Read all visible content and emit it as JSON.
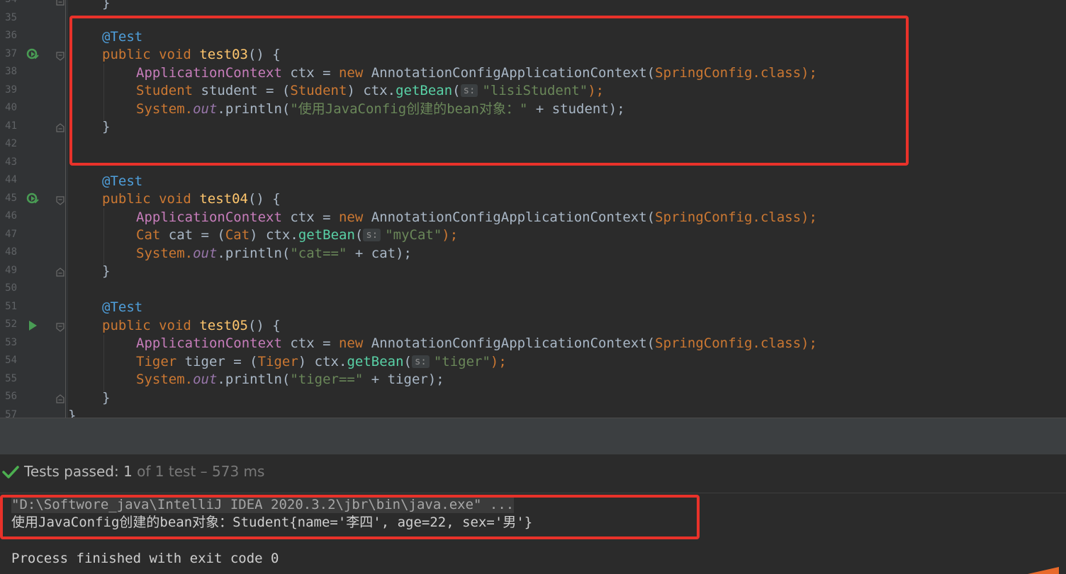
{
  "editor": {
    "line_numbers": [
      "34",
      "35",
      "36",
      "37",
      "38",
      "39",
      "40",
      "41",
      "42",
      "43",
      "44",
      "45",
      "46",
      "47",
      "48",
      "49",
      "50",
      "51",
      "52",
      "53",
      "54",
      "55",
      "56",
      "57"
    ],
    "test03": {
      "annotation": "@Test",
      "kw_public": "public",
      "kw_void": "void",
      "method": "test03",
      "sig_rest": "() {",
      "line1": {
        "type": "ApplicationContext",
        "var": " ctx = ",
        "kw_new": "new",
        "ctor": " AnnotationConfigApplicationContext(",
        "config": "SpringConfig",
        "dot_class": ".class",
        "end": ");"
      },
      "line2": {
        "type": "Student",
        "mid": " student = (",
        "cast": "Student",
        "pre": ") ctx.",
        "call": "getBean",
        "paren": "(",
        "hint": "s:",
        "str": "\"lisiStudent\"",
        "end": ");"
      },
      "line3": {
        "sys": "System.",
        "out": "out",
        "println": ".println(",
        "str": "\"使用JavaConfig创建的bean对象：\"",
        "rest": " + student);"
      },
      "close": "}"
    },
    "test04": {
      "annotation": "@Test",
      "kw_public": "public",
      "kw_void": "void",
      "method": "test04",
      "sig_rest": "() {",
      "line1": {
        "type": "ApplicationContext",
        "var": " ctx = ",
        "kw_new": "new",
        "ctor": " AnnotationConfigApplicationContext(",
        "config": "SpringConfig",
        "dot_class": ".class",
        "end": ");"
      },
      "line2": {
        "type": "Cat",
        "mid": " cat = (",
        "cast": "Cat",
        "pre": ") ctx.",
        "call": "getBean",
        "paren": "(",
        "hint": "s:",
        "str": "\"myCat\"",
        "end": ");"
      },
      "line3": {
        "sys": "System.",
        "out": "out",
        "println": ".println(",
        "str": "\"cat==\"",
        "rest": " + cat);"
      },
      "close": "}"
    },
    "test05": {
      "annotation": "@Test",
      "kw_public": "public",
      "kw_void": "void",
      "method": "test05",
      "sig_rest": "() {",
      "line1": {
        "type": "ApplicationContext",
        "var": " ctx = ",
        "kw_new": "new",
        "ctor": " AnnotationConfigApplicationContext(",
        "config": "SpringConfig",
        "dot_class": ".class",
        "end": ");"
      },
      "line2": {
        "type": "Tiger",
        "mid": " tiger = (",
        "cast": "Tiger",
        "pre": ") ctx.",
        "call": "getBean",
        "paren": "(",
        "hint": "s:",
        "str": "\"tiger\"",
        "end": ");"
      },
      "line3": {
        "sys": "System.",
        "out": "out",
        "println": ".println(",
        "str": "\"tiger==\"",
        "rest": " + tiger);"
      },
      "close": "}"
    },
    "prev_close": "}",
    "class_close": "}"
  },
  "test_status": {
    "label": "Tests passed: ",
    "count": "1",
    "detail": " of 1 test – 573 ms"
  },
  "console": {
    "cmd": "\"D:\\Softwore_java\\IntelliJ IDEA 2020.3.2\\jbr\\bin\\java.exe\" ...",
    "output": "使用JavaConfig创建的bean对象：Student{name='李四', age=22, sex='男'}",
    "exit": "Process finished with exit code 0"
  },
  "colors": {
    "highlight_box": "#e8322a",
    "passed_check": "#4caf50",
    "run_icon": "#499c54"
  }
}
